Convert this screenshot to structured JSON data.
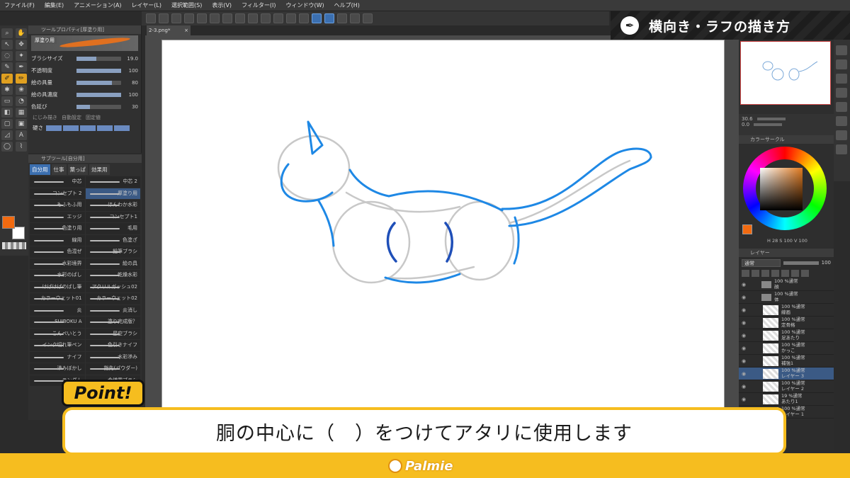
{
  "menu": [
    "ファイル(F)",
    "編集(E)",
    "アニメーション(A)",
    "レイヤー(L)",
    "選択範囲(S)",
    "表示(V)",
    "フィルター(I)",
    "ウィンドウ(W)",
    "ヘルプ(H)"
  ],
  "tool_property": {
    "header": "ツールプロパティ[厚塗り用]",
    "brush_name": "厚塗り用",
    "rows": [
      {
        "label": "ブラシサイズ",
        "value": "19.0",
        "level": 0.45
      },
      {
        "label": "不透明度",
        "value": "100",
        "level": 1.0
      },
      {
        "label": "絵の具量",
        "value": "80",
        "level": 0.8
      },
      {
        "label": "絵の具濃度",
        "value": "100",
        "level": 1.0
      },
      {
        "label": "色延び",
        "value": "30",
        "level": 0.3
      }
    ],
    "options": [
      "にじみ描き",
      "自動設定",
      "固定値"
    ],
    "hardness_label": "硬さ"
  },
  "sub_tool": {
    "header": "サブツール[自分用]",
    "tabs": [
      "自分用",
      "仕事",
      "葉っぱ",
      "効果用"
    ],
    "brushes": [
      "中芯",
      "中芯 2",
      "コンセプト 2",
      "厚塗り用",
      "もふもふ用",
      "ほんわか水彩",
      "エッジ",
      "コンセプト1",
      "色塗り用",
      "毛用",
      "線用",
      "色塗ざ",
      "色混ぜ",
      "鉛筆ブラシ",
      "水彩境界",
      "絵の具",
      "水彩のばし",
      "乾燥水彩",
      "けばけばのばし筆",
      "アクリルガッシュ02",
      "カラーウェット01",
      "カラーウェット02",
      "炎",
      "炎消し",
      "SUIBOKU A",
      "塗り完成版？",
      "こんぺいとう",
      "星空ブラシ",
      "インク切れ筆ペン",
      "色引きナイフ",
      "ナイフ",
      "水彩滲み",
      "滲みぼかし",
      "指先(パウダー)",
      "ランダム",
      "金繕霧ブラシ"
    ],
    "selected": "厚塗り用"
  },
  "document": {
    "tab": "2-3.png*"
  },
  "title": "横向き・ラフの描き方",
  "point_label": "Point!",
  "caption": "胴の中心に（　）をつけてアタリに使用します",
  "brand": "Palmie",
  "navigator": {
    "zoom": "30.6",
    "angle": "0.0"
  },
  "color_panel": {
    "header": "カラーサークル",
    "values": "H 28  S 100  V 100"
  },
  "layers": {
    "header": "レイヤー",
    "blend_mode": "通常",
    "opacity": "100",
    "items": [
      {
        "text": "100 %通常\n顔",
        "type": "folder"
      },
      {
        "text": "100 %通常\n体",
        "type": "folder"
      },
      {
        "text": "100 %通常\n線画",
        "type": "layer"
      },
      {
        "text": "100 %通常\n定骨格",
        "type": "layer"
      },
      {
        "text": "100 %通常\n足あたり",
        "type": "layer"
      },
      {
        "text": "100 %通常\nかっこ",
        "type": "layer"
      },
      {
        "text": "100 %通常\n補強1",
        "type": "layer"
      },
      {
        "text": "100 %通常\nレイヤー 3",
        "type": "layer",
        "active": true
      },
      {
        "text": "100 %通常\nレイヤー 2",
        "type": "layer"
      },
      {
        "text": "19 %通常\nあたり1",
        "type": "layer"
      },
      {
        "text": "100 %通常\nレイヤー 1",
        "type": "layer"
      }
    ]
  },
  "colors": {
    "accent_yellow": "#f6bd1f",
    "stroke_blue": "#1e88e5",
    "stroke_gray": "#c8c8c8",
    "mark_blue": "#1f4fb8",
    "foreground": "#f26a10"
  }
}
